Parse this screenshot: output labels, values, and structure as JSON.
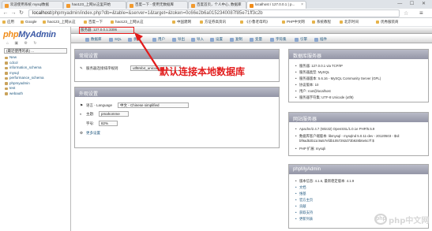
{
  "browser": {
    "tabs": [
      {
        "label": "欢迎使用系统 mysql数据",
        "active": false
      },
      {
        "label": "hao123_上网从这里开始",
        "active": false
      },
      {
        "label": "百度一下 - 使用无数据库",
        "active": false
      },
      {
        "label": "百度首页，个人中心, 数据库",
        "active": false
      },
      {
        "label": "localhost / 127.0.0.1 | p...",
        "active": true
      }
    ],
    "window_controls": "— ☐ ✕",
    "url_host": "localhost",
    "url_path": "/phpmyadmin/index.php?db=&table=&server=1&target=&token=0c66e2b6a0152340087f85e71ff3c2b",
    "bookmarks": [
      "应用",
      "Google",
      "hao123_上网从这",
      "百度一下",
      "hao123_上网从这",
      "中国建网",
      "方证券高资讯",
      "《小鲁老母鸡》",
      "PHP中文网",
      "系统教程",
      "北京时间",
      "优秀服装商"
    ]
  },
  "sidebar": {
    "logo_php": "php",
    "logo_myadmin": "MyAdmin",
    "icons": "⌂ ▣ ⚙ ↻",
    "db_select": "(最近使用的表) ...",
    "databases": [
      "New",
      "cdcol",
      "information_schema",
      "mysql",
      "performance_schema",
      "phpmyadmin",
      "test",
      "webauth"
    ]
  },
  "serverbar": {
    "label": "服务器: 127.0.0.1:3306"
  },
  "menu": [
    "数据库",
    "SQL",
    "状态",
    "用户",
    "导出",
    "导入",
    "设置",
    "复制",
    "变量",
    "字符集",
    "引擎",
    "插件"
  ],
  "general_settings": {
    "title": "常规设置",
    "collation_label": "服务器连接排序规则",
    "collation_value": "utf8mb4_unicode_ci"
  },
  "appearance": {
    "title": "外观设置",
    "language_label": "语言 - Language",
    "language_value": "中文 - Chinese simplified",
    "theme_label": "主题:",
    "theme_value": "pmahomme",
    "fontsize_label": "字号:",
    "fontsize_value": "82%",
    "more_label": "更多设置"
  },
  "db_server": {
    "title": "数据库服务器",
    "items": [
      "服务器: 127.0.0.1 via TCP/IP",
      "服务器类型: MySQL",
      "服务器版本: 5.6.16 - MySQL Community Server (GPL)",
      "协议版本: 10",
      "用户: root@localhost",
      "服务器字符集: UTF-8 Unicode (utf8)"
    ]
  },
  "web_server": {
    "title": "网站服务器",
    "items": [
      "Apache/2.4.7 (Win32) OpenSSL/1.0.1e PHP/5.5.9",
      "数据库客户端版本: libmysql - mysqlnd 5.0.11-dev - 20120503 - $Id: bf9ad53b11c9a57efdb1057292d73b928b6e5c7f $",
      "PHP 扩展: mysqli"
    ]
  },
  "pma_info": {
    "title": "phpMyAdmin",
    "version_label": "版本信息: 4.1.6, 最新稳定版本: 4.1.9",
    "links": [
      "文档",
      "维基",
      "官方主页",
      "贡献",
      "获取支持",
      "更新列表"
    ]
  },
  "annotation": "默认连接本地数据库",
  "watermark": "php中文网",
  "colors": {
    "accent": "#3d5aa6",
    "annotation": "#e21b1b",
    "panel_header": "#9b9daf"
  }
}
